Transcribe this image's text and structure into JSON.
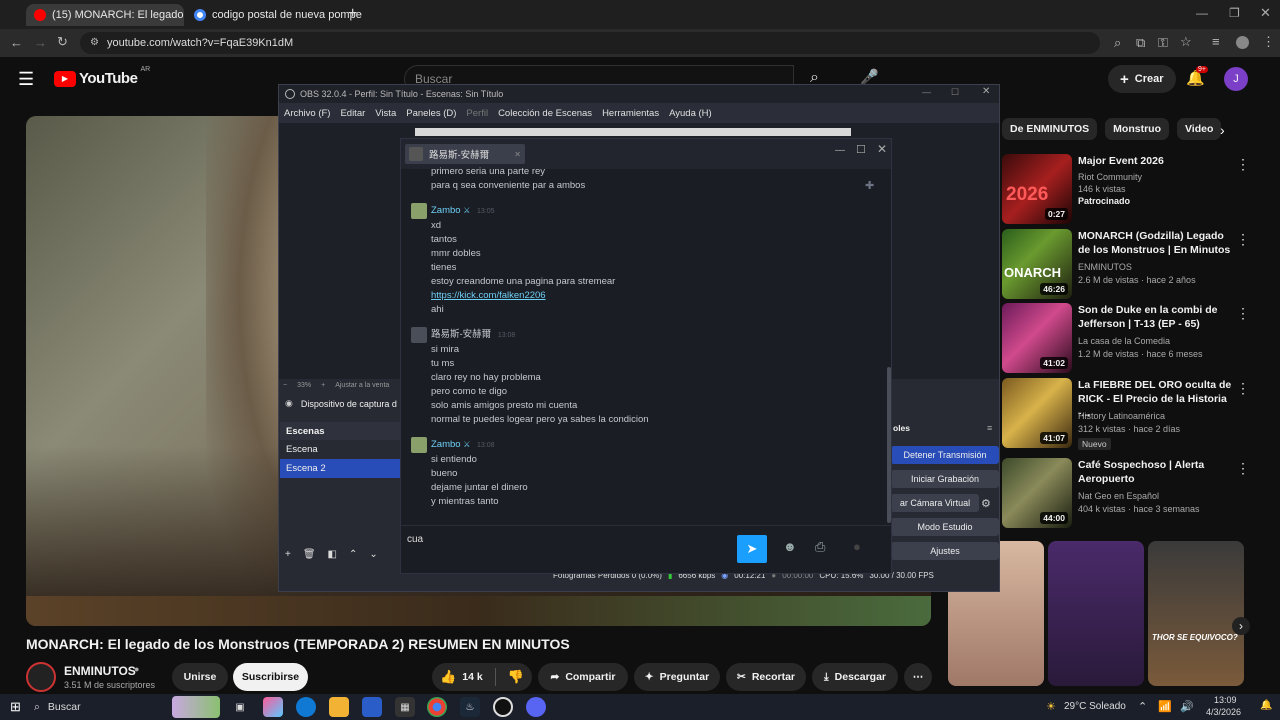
{
  "browser": {
    "tabs": [
      {
        "label": "(15) MONARCH: El legado d",
        "active": true
      },
      {
        "label": "codigo postal de nueva pompe",
        "active": false
      }
    ],
    "new_tab": "+",
    "url": "youtube.com/watch?v=FqaE39Kn1dM"
  },
  "youtube": {
    "logo": "YouTube",
    "region": "AR",
    "search_placeholder": "Buscar",
    "create_label": "Crear",
    "notif_count": "9+",
    "avatar_letter": "J",
    "chips": [
      "De ENMINUTOS",
      "Monstruo",
      "Video"
    ],
    "video_title": "MONARCH: El legado de los Monstruos (TEMPORADA 2) RESUMEN EN MINUTOS",
    "channel": "ENMINUTOS",
    "subscribers": "3.51 M de suscriptores",
    "join_label": "Unirse",
    "subscribe_label": "Suscribirse",
    "likes": "14 k",
    "share_label": "Compartir",
    "ask_label": "Preguntar",
    "clip_label": "Recortar",
    "download_label": "Descargar",
    "suggestions": [
      {
        "title": "Major Event 2026",
        "meta1": "Riot Community",
        "meta2": "146 k vistas",
        "meta3": "Patrocinado",
        "duration": "0:27"
      },
      {
        "title": "MONARCH (Godzilla) Legado de los Monstruos | En Minutos",
        "meta1": "ENMINUTOS",
        "meta2": "2.6 M de vistas · hace 2 años",
        "meta3": "",
        "duration": "46:26"
      },
      {
        "title": "Son de Duke en la combi de Jefferson | T-13 (EP - 65)",
        "meta1": "La casa de la Comedia",
        "meta2": "1.2 M de vistas · hace 6 meses",
        "meta3": "",
        "duration": "41:02"
      },
      {
        "title": "La FIEBRE DEL ORO oculta de RICK - El Precio de la Historia -...",
        "meta1": "History Latinoamérica",
        "meta2": "312 k vistas · hace 2 días",
        "meta3": "Nuevo",
        "duration": "41:07"
      },
      {
        "title": "Café Sospechoso | Alerta Aeropuerto",
        "meta1": "Nat Geo en Español",
        "meta2": "404 k vistas · hace 3 semanas",
        "meta3": "",
        "duration": "44:00"
      }
    ],
    "shorts_caption": "THOR SE EQUIVOCO?"
  },
  "obs": {
    "title": "OBS 32.0.4 - Perfil: Sin Título - Escenas: Sin Título",
    "menu": [
      "Archivo (F)",
      "Editar",
      "Vista",
      "Paneles (D)",
      "Perfil",
      "Colección de Escenas",
      "Herramientas",
      "Ayuda (H)"
    ],
    "zoom": "33%",
    "zoom_hint": "Ajustar a la venta",
    "source": "Dispositivo de captura d",
    "scenes_header": "Escenas",
    "scenes": [
      "Escena",
      "Escena 2"
    ],
    "controls_header": "oles",
    "controls": [
      "Detener Transmisión",
      "Iniciar Grabación",
      "ar Cámara Virtual",
      "Modo Estudio",
      "Ajustes"
    ],
    "status": {
      "dropped": "Fotogramas Perdidos 0 (0.0%)",
      "bitrate": "6656 kbps",
      "stream_time": "00:12:21",
      "rec_time": "00:00:00",
      "cpu": "CPU: 15.6%",
      "fps": "30.00 / 30.00 FPS"
    }
  },
  "chat": {
    "contact": "路易斯-安赫爾",
    "input_text": "cua",
    "messages": [
      {
        "user": "",
        "time": "",
        "lines": [
          "primero seria una parte rey",
          "para q sea conveniente par a ambos"
        ]
      },
      {
        "user": "Zambo",
        "time": "13:05",
        "lines": [
          "xd",
          "tantos",
          "mmr dobles",
          "tienes",
          "estoy creandome una pagina para stremear",
          "https://kick.com/falken2206",
          "ahi"
        ]
      },
      {
        "user": "路易斯-安赫爾",
        "time": "13:08",
        "lines": [
          "si mira",
          "tu ms",
          "claro rey no hay problema",
          "pero como te digo",
          "solo amis amigos presto mi cuenta",
          "normal te puedes logear pero ya sabes la condicion"
        ]
      },
      {
        "user": "Zambo",
        "time": "13:08",
        "lines": [
          "si entiendo",
          "bueno",
          "dejame juntar el dinero",
          "y mientras tanto"
        ]
      }
    ]
  },
  "taskbar": {
    "search": "Buscar",
    "weather": "29°C  Soleado",
    "time": "13:09",
    "date": "4/3/2026"
  }
}
